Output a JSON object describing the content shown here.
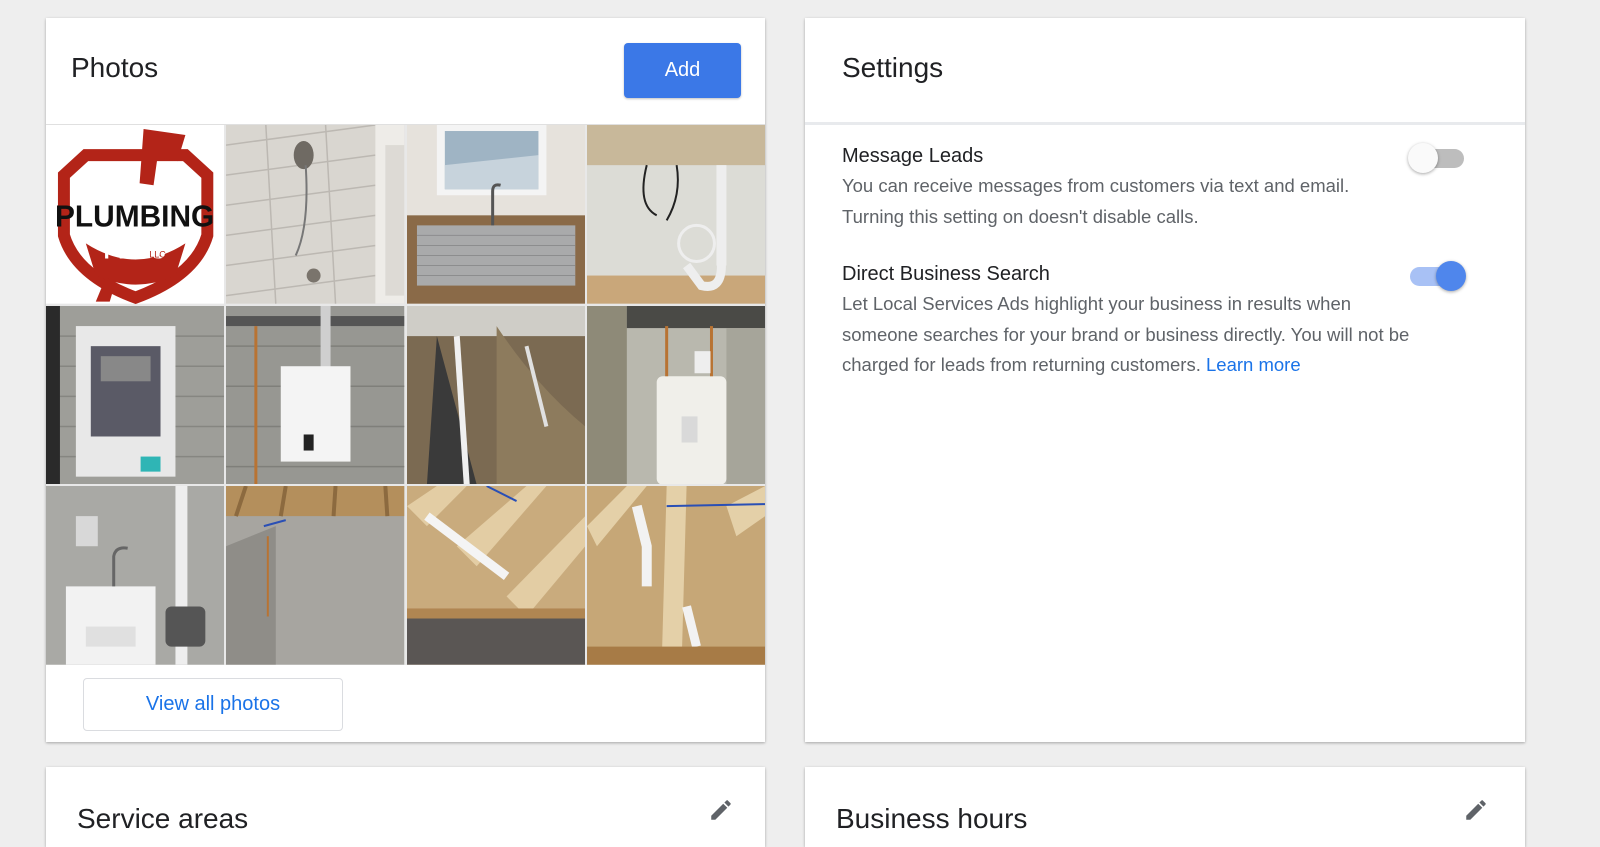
{
  "photos": {
    "title": "Photos",
    "add_label": "Add",
    "view_all_label": "View all photos",
    "logo_text": {
      "main": "PLUMBING",
      "sub": "PROS",
      "suffix": "LLC"
    },
    "items": [
      {
        "icon": "plumbing-pros-logo"
      },
      {
        "icon": "shower-photo"
      },
      {
        "icon": "kitchen-sink-photo"
      },
      {
        "icon": "sink-drain-pipes-photo"
      },
      {
        "icon": "boiler-unit-photo"
      },
      {
        "icon": "tankless-water-heater-photo"
      },
      {
        "icon": "trench-pipe-photo"
      },
      {
        "icon": "water-heater-tank-photo"
      },
      {
        "icon": "utility-sink-photo"
      },
      {
        "icon": "basement-wall-photo"
      },
      {
        "icon": "ceiling-joist-pipes-photo"
      },
      {
        "icon": "ceiling-joist-drain-photo"
      }
    ]
  },
  "settings": {
    "title": "Settings",
    "items": [
      {
        "title": "Message Leads",
        "description": "You can receive messages from customers via text and email. Turning this setting on doesn't disable calls.",
        "enabled": false
      },
      {
        "title": "Direct Business Search",
        "description": "Let Local Services Ads highlight your business in results when someone searches for your brand or business directly. You will not be charged for leads from returning customers.",
        "link_label": "Learn more",
        "enabled": true
      }
    ]
  },
  "service_areas": {
    "title": "Service areas",
    "edit_icon": "pencil-icon"
  },
  "business_hours": {
    "title": "Business hours",
    "edit_icon": "pencil-icon"
  },
  "colors": {
    "primary": "#3b78e7",
    "link": "#1a73e8",
    "toggle_on_thumb": "#4f86ec",
    "toggle_on_track": "#a8c1f5",
    "toggle_off_track": "#bdbdbd",
    "background": "#eeeeee"
  }
}
